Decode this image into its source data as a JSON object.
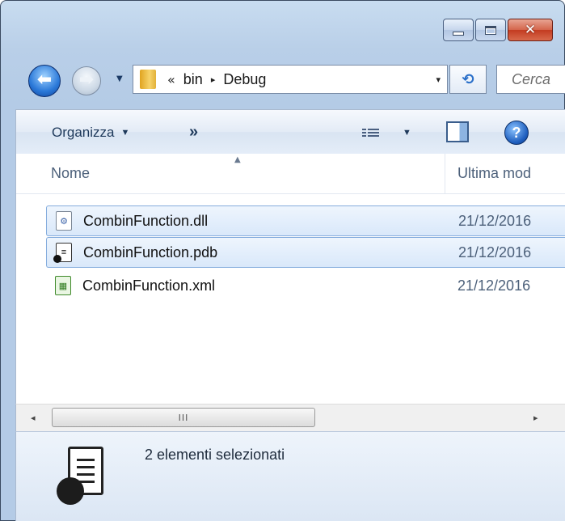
{
  "window": {
    "title": "",
    "caption_buttons": {
      "minimize": "minimize",
      "maximize": "maximize",
      "close": "✕"
    }
  },
  "address_bar": {
    "overflow_glyph": "«",
    "breadcrumbs": [
      "bin",
      "Debug"
    ],
    "separator_glyph": "▸",
    "dropdown_glyph": "▾",
    "refresh_glyph": "⟲"
  },
  "search": {
    "placeholder": "Cerca Debug",
    "visible_text": "Cerca"
  },
  "command_bar": {
    "organize_label": "Organizza",
    "organize_caret": "▼",
    "more_label": "»",
    "views_caret": "▼",
    "help_glyph": "?"
  },
  "columns": {
    "name": "Nome",
    "date": "Ultima mod",
    "sort_glyph": "▲"
  },
  "files": [
    {
      "name": "CombinFunction.dll",
      "date": "21/12/2016",
      "selected": true,
      "icon": "dll-file-icon",
      "glyph": "⚙"
    },
    {
      "name": "CombinFunction.pdb",
      "date": "21/12/2016",
      "selected": true,
      "icon": "pdb-file-icon",
      "glyph": "≡"
    },
    {
      "name": "CombinFunction.xml",
      "date": "21/12/2016",
      "selected": false,
      "icon": "xml-file-icon",
      "glyph": "▦"
    }
  ],
  "scrollbar": {
    "left_glyph": "◂",
    "right_glyph": "▸",
    "grip": "III"
  },
  "details": {
    "selection_text": "2 elementi selezionati"
  },
  "colors": {
    "accent": "#2a78d8",
    "selection_border": "#84acdd",
    "header_text": "#4c607a",
    "close_button": "#c33b21"
  }
}
